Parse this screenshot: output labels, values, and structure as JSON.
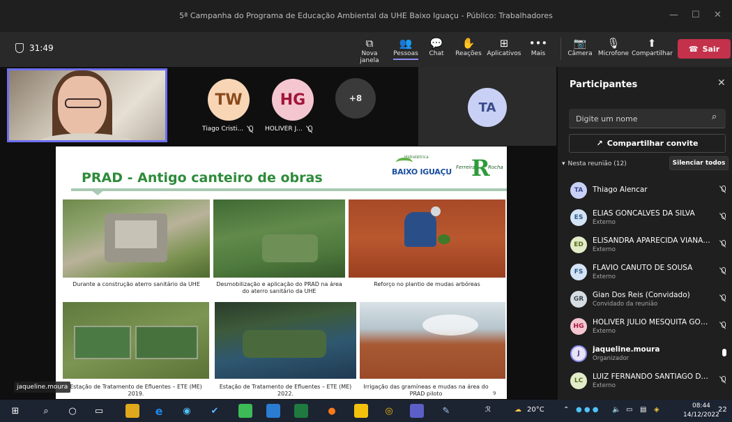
{
  "window": {
    "title": "5ª Campanha do Programa de Educação Ambiental da UHE Baixo Iguaçu - Público: Trabalhadores",
    "minimize": "—",
    "maximize": "☐",
    "close": "✕"
  },
  "toolbar": {
    "timer": "31:49",
    "buttons": {
      "new_window": "Nova janela",
      "people": "Pessoas",
      "chat": "Chat",
      "reactions": "Reações",
      "apps": "Aplicativos",
      "more": "Mais",
      "camera": "Câmera",
      "mic": "Microfone",
      "share": "Compartilhar"
    },
    "leave": "Sair"
  },
  "stage": {
    "tiles": [
      {
        "initials": "TW",
        "name": "Tiago Cristi...",
        "color": "#f8d5b5"
      },
      {
        "initials": "HG",
        "name": "HOLIVER J...",
        "color": "#f4c6d0"
      },
      {
        "initials": "+8"
      },
      {
        "initials": "TA",
        "color": "#c8d1f5"
      }
    ],
    "presenter_name": "jaqueline.moura"
  },
  "slide": {
    "title": "PRAD - Antigo canteiro de obras",
    "logo_tag": "Hidrelétrica",
    "logo_name": "BAIXO IGUAÇU",
    "logo2_left": "Ferreira",
    "logo2_letter": "R",
    "logo2_right": "Rocha",
    "captions": [
      "Durante a construção aterro sanitário da UHE",
      "Desmobilização e aplicação do PRAD na área do aterro sanitário da UHE",
      "Reforço no plantio de mudas arbóreas",
      "Estação de Tratamento de Efluentes – ETE (ME) 2019.",
      "Estação de Tratamento de Efluentes – ETE (ME) 2022.",
      "Irrigação das gramíneas e mudas na área do PRAD piloto"
    ],
    "page": "9"
  },
  "panel": {
    "title": "Participantes",
    "search_placeholder": "Digite um nome",
    "invite": "Compartilhar convite",
    "section": "Nesta reunião (12)",
    "mute_all": "Silenciar todos",
    "participants": [
      {
        "initials": "TA",
        "name": "Thiago Alencar",
        "role": "",
        "color": "#c8d1f5",
        "fg": "#3d4a8a"
      },
      {
        "initials": "ES",
        "name": "ELIAS GONCALVES DA SILVA",
        "role": "Externo",
        "color": "#d4e3f5",
        "fg": "#2a5a8a"
      },
      {
        "initials": "ED",
        "name": "ELISANDRA APARECIDA VIANA ...",
        "role": "Externo",
        "color": "#e2ecc8",
        "fg": "#5a6e1e"
      },
      {
        "initials": "FS",
        "name": "FLAVIO CANUTO DE SOUSA",
        "role": "Externo",
        "color": "#d4e3f5",
        "fg": "#2a5a8a"
      },
      {
        "initials": "GR",
        "name": "Gian Dos Reis (Convidado)",
        "role": "Convidado da reunião",
        "color": "#d6dde2",
        "fg": "#3b4a55"
      },
      {
        "initials": "HG",
        "name": "HOLIVER JULIO MESQUITA GON...",
        "role": "Externo",
        "color": "#f4c6d0",
        "fg": "#a2153a"
      },
      {
        "initials": "J",
        "name": "jaqueline.moura",
        "role": "Organizador",
        "color": "#e8e3f5",
        "fg": "#4a3d8a",
        "organizer": true
      },
      {
        "initials": "LC",
        "name": "LUIZ FERNANDO SANTIAGO DE ...",
        "role": "Externo",
        "color": "#e2ecc8",
        "fg": "#5a6e1e"
      }
    ]
  },
  "taskbar": {
    "weather": "20°C",
    "time": "08:44",
    "date": "14/12/2022",
    "notifications": "22"
  }
}
